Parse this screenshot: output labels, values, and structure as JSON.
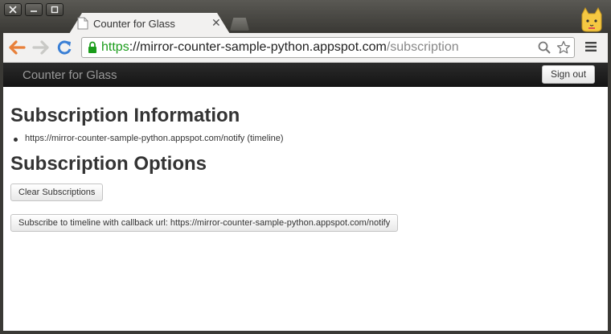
{
  "window": {
    "tab_title": "Counter for Glass",
    "controls": {
      "close": "✕",
      "minimize": "—",
      "maximize": "☐"
    }
  },
  "toolbar": {
    "url_scheme": "https",
    "url_separator": "://",
    "url_host": "mirror-counter-sample-python.appspot.com",
    "url_path": "/subscription"
  },
  "navbar": {
    "brand": "Counter for Glass",
    "signout_label": "Sign out"
  },
  "main": {
    "info_heading": "Subscription Information",
    "subscriptions": [
      "https://mirror-counter-sample-python.appspot.com/notify (timeline)"
    ],
    "options_heading": "Subscription Options",
    "clear_label": "Clear Subscriptions",
    "subscribe_label": "Subscribe to timeline with callback url: https://mirror-counter-sample-python.appspot.com/notify"
  },
  "colors": {
    "secure_green": "#1a9c1a",
    "navbar_bg": "#1b1b1b",
    "back_arrow": "#e8803a",
    "reload": "#3a7fd5"
  }
}
